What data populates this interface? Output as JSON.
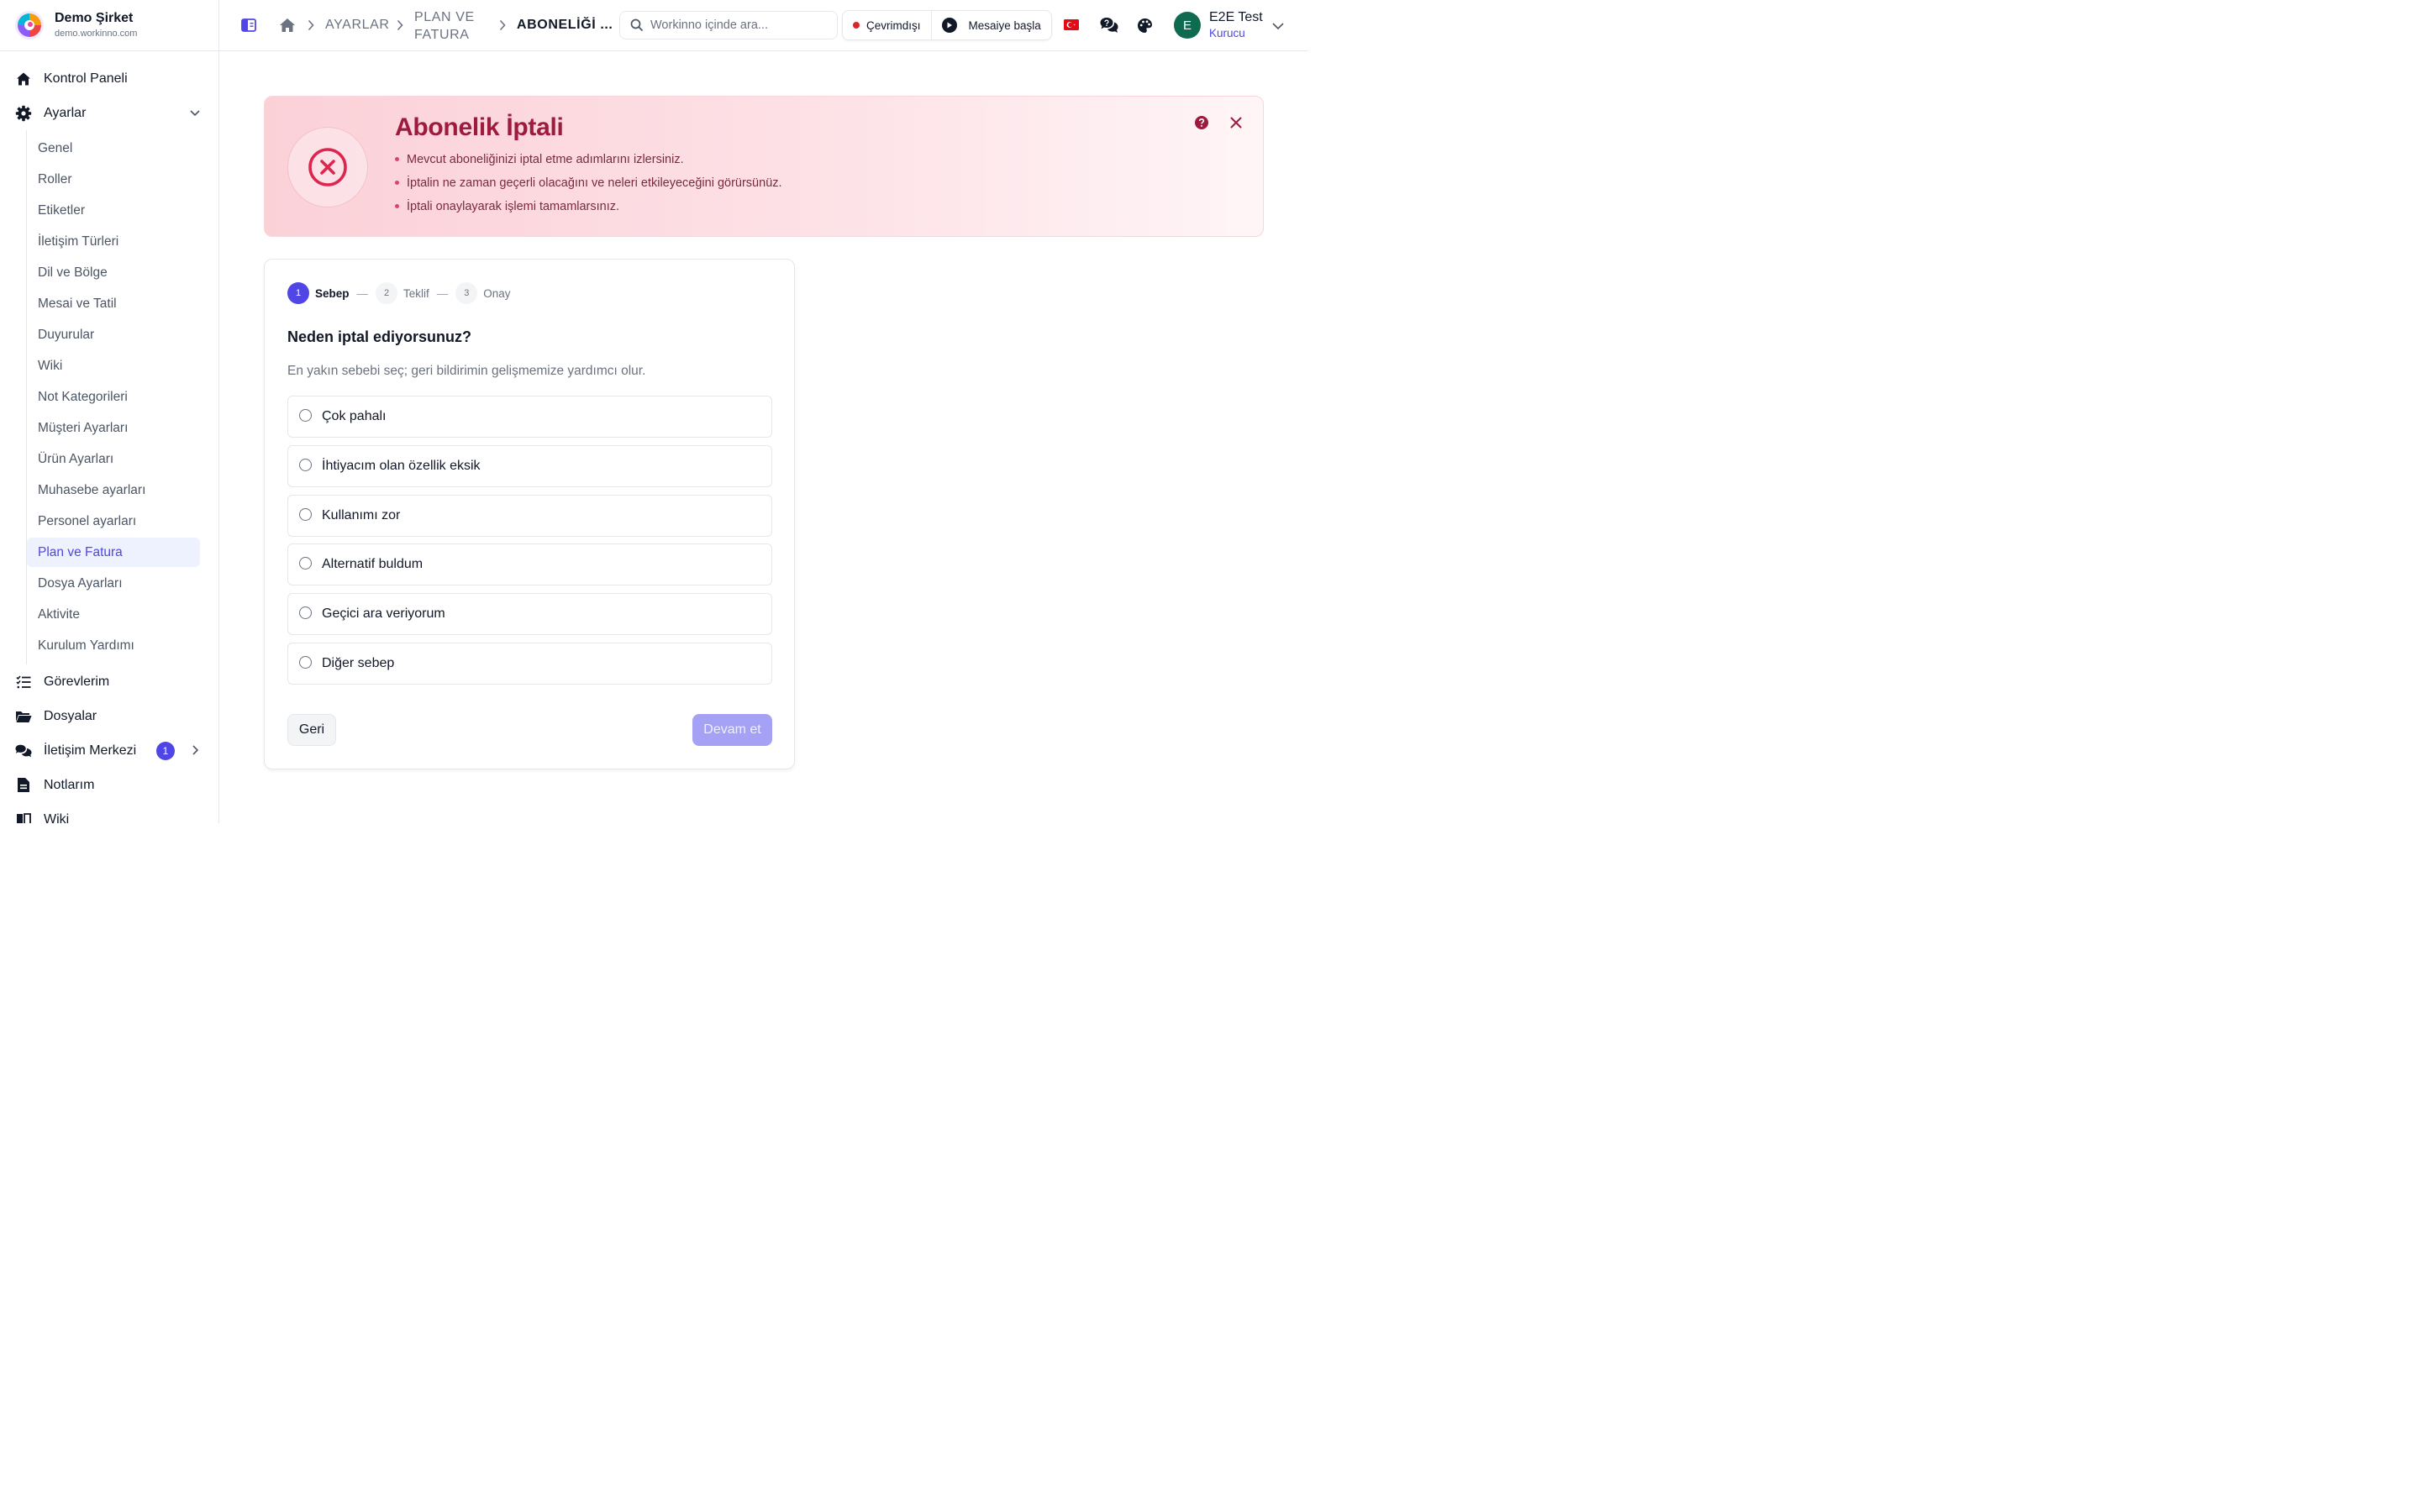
{
  "brand": {
    "name": "Demo Şirket",
    "domain": "demo.workinno.com"
  },
  "sidebar": {
    "top_items": [
      {
        "label": "Kontrol Paneli",
        "icon": "home-icon"
      },
      {
        "label": "Ayarlar",
        "icon": "gear-icon",
        "expanded": true
      }
    ],
    "settings_items": [
      "Genel",
      "Roller",
      "Etiketler",
      "İletişim Türleri",
      "Dil ve Bölge",
      "Mesai ve Tatil",
      "Duyurular",
      "Wiki",
      "Not Kategorileri",
      "Müşteri Ayarları",
      "Ürün Ayarları",
      "Muhasebe ayarları",
      "Personel ayarları",
      "Plan ve Fatura",
      "Dosya Ayarları",
      "Aktivite",
      "Kurulum Yardımı"
    ],
    "active_settings_item": "Plan ve Fatura",
    "bottom_items": [
      {
        "label": "Görevlerim",
        "icon": "tasks-icon"
      },
      {
        "label": "Dosyalar",
        "icon": "folder-icon"
      },
      {
        "label": "İletişim Merkezi",
        "icon": "chat-icon",
        "badge": "1"
      },
      {
        "label": "Notlarım",
        "icon": "note-icon"
      },
      {
        "label": "Wiki",
        "icon": "book-icon"
      }
    ]
  },
  "topbar": {
    "breadcrumb": {
      "level1": "AYARLAR",
      "level2_line1": "PLAN VE",
      "level2_line2": "FATURA",
      "current": "ABONELİĞİ ..."
    },
    "search_placeholder": "Workinno içinde ara...",
    "status_label": "Çevrimdışı",
    "shift_label": "Mesaiye başla",
    "user": {
      "initial": "E",
      "name": "E2E Test",
      "role": "Kurucu"
    }
  },
  "hero": {
    "title": "Abonelik İptali",
    "bullets": [
      "Mevcut aboneliğinizi iptal etme adımlarını izlersiniz.",
      "İptalin ne zaman geçerli olacağını ve neleri etkileyeceğini görürsünüz.",
      "İptali onaylayarak işlemi tamamlarsınız."
    ]
  },
  "wizard": {
    "steps": [
      {
        "num": "1",
        "label": "Sebep",
        "active": true
      },
      {
        "num": "2",
        "label": "Teklif",
        "active": false
      },
      {
        "num": "3",
        "label": "Onay",
        "active": false
      }
    ],
    "question": "Neden iptal ediyorsunuz?",
    "subtitle": "En yakın sebebi seç; geri bildirimin gelişmemize yardımcı olur.",
    "options": [
      "Çok pahalı",
      "İhtiyacım olan özellik eksik",
      "Kullanımı zor",
      "Alternatif buldum",
      "Geçici ara veriyorum",
      "Diğer sebep"
    ],
    "back_label": "Geri",
    "next_label": "Devam et"
  },
  "colors": {
    "accent": "#4f46e5",
    "hero_title": "#9d1b3c",
    "next_disabled": "#a5a1f4",
    "status_offline": "#dc2626"
  }
}
